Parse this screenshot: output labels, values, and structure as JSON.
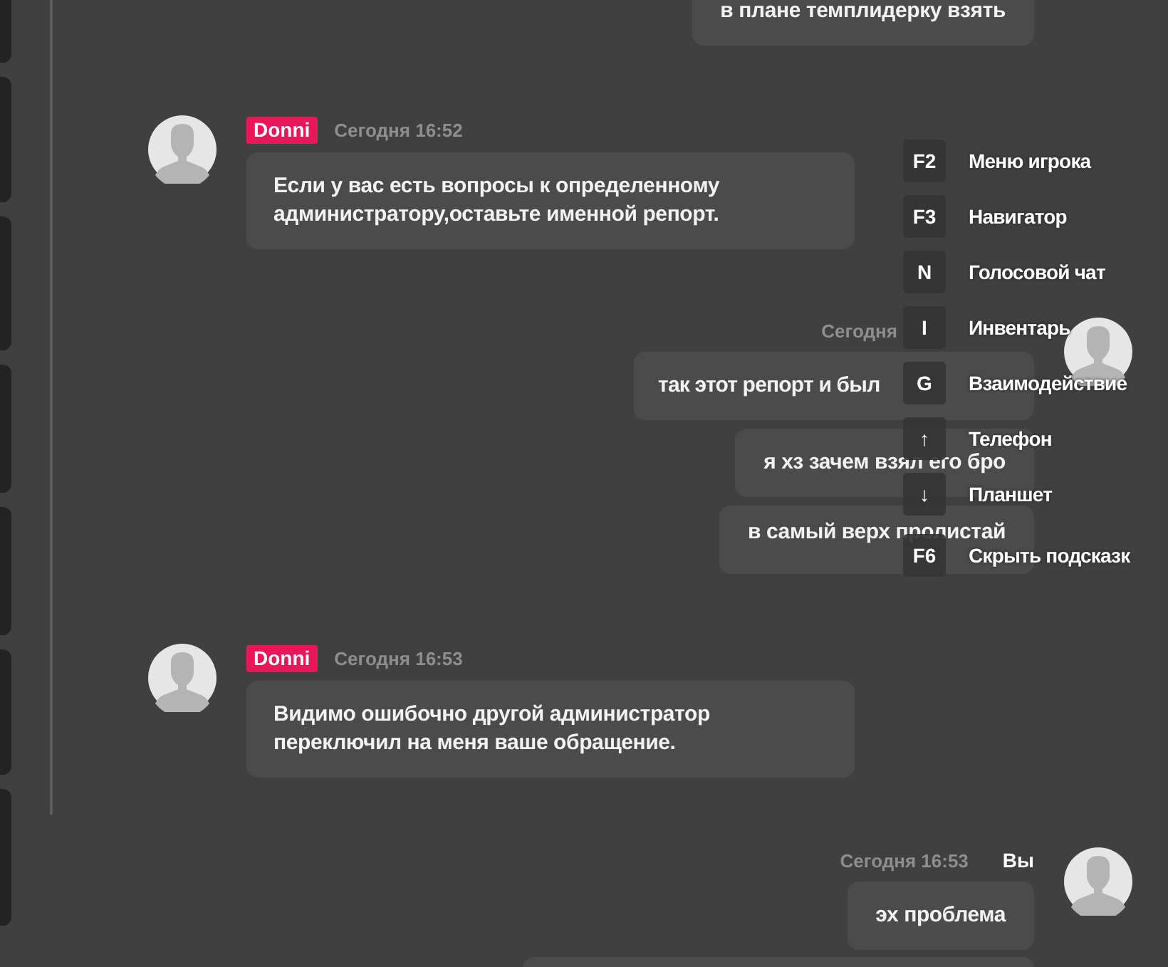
{
  "messages": [
    {
      "kind": "outgoing",
      "avatar": false,
      "bubbles": [
        "в плане темплидерку взять"
      ]
    },
    {
      "kind": "incoming",
      "badge": "Donni",
      "time": "Сегодня 16:52",
      "bubbles": [
        "Если у вас есть вопросы к определенному администратору,оставьте именной репорт."
      ]
    },
    {
      "kind": "outgoing",
      "avatar": true,
      "time": "Сегодня",
      "bubbles": [
        "так этот репорт и был",
        "я хз зачем взял его бро",
        "в самый верх пролистай"
      ]
    },
    {
      "kind": "incoming",
      "badge": "Donni",
      "time": "Сегодня 16:53",
      "bubbles": [
        "Видимо ошибочно другой администратор переключил на меня ваше обращение."
      ]
    },
    {
      "kind": "outgoing",
      "avatar": true,
      "time": "Сегодня 16:53",
      "sender": "Вы",
      "bubbles": [
        "эх проблема"
      ]
    },
    {
      "kind": "partial"
    }
  ],
  "hints": [
    {
      "key": "F2",
      "label": "Меню игрока"
    },
    {
      "key": "F3",
      "label": "Навигатор"
    },
    {
      "key": "N",
      "label": "Голосовой чат"
    },
    {
      "key": "I",
      "label": "Инвентарь"
    },
    {
      "key": "G",
      "label": "Взаимодействие"
    },
    {
      "key": "↑",
      "label": "Телефон"
    },
    {
      "key": "↓",
      "label": "Планшет"
    },
    {
      "key": "F6",
      "label": "Скрыть подсказк"
    }
  ]
}
